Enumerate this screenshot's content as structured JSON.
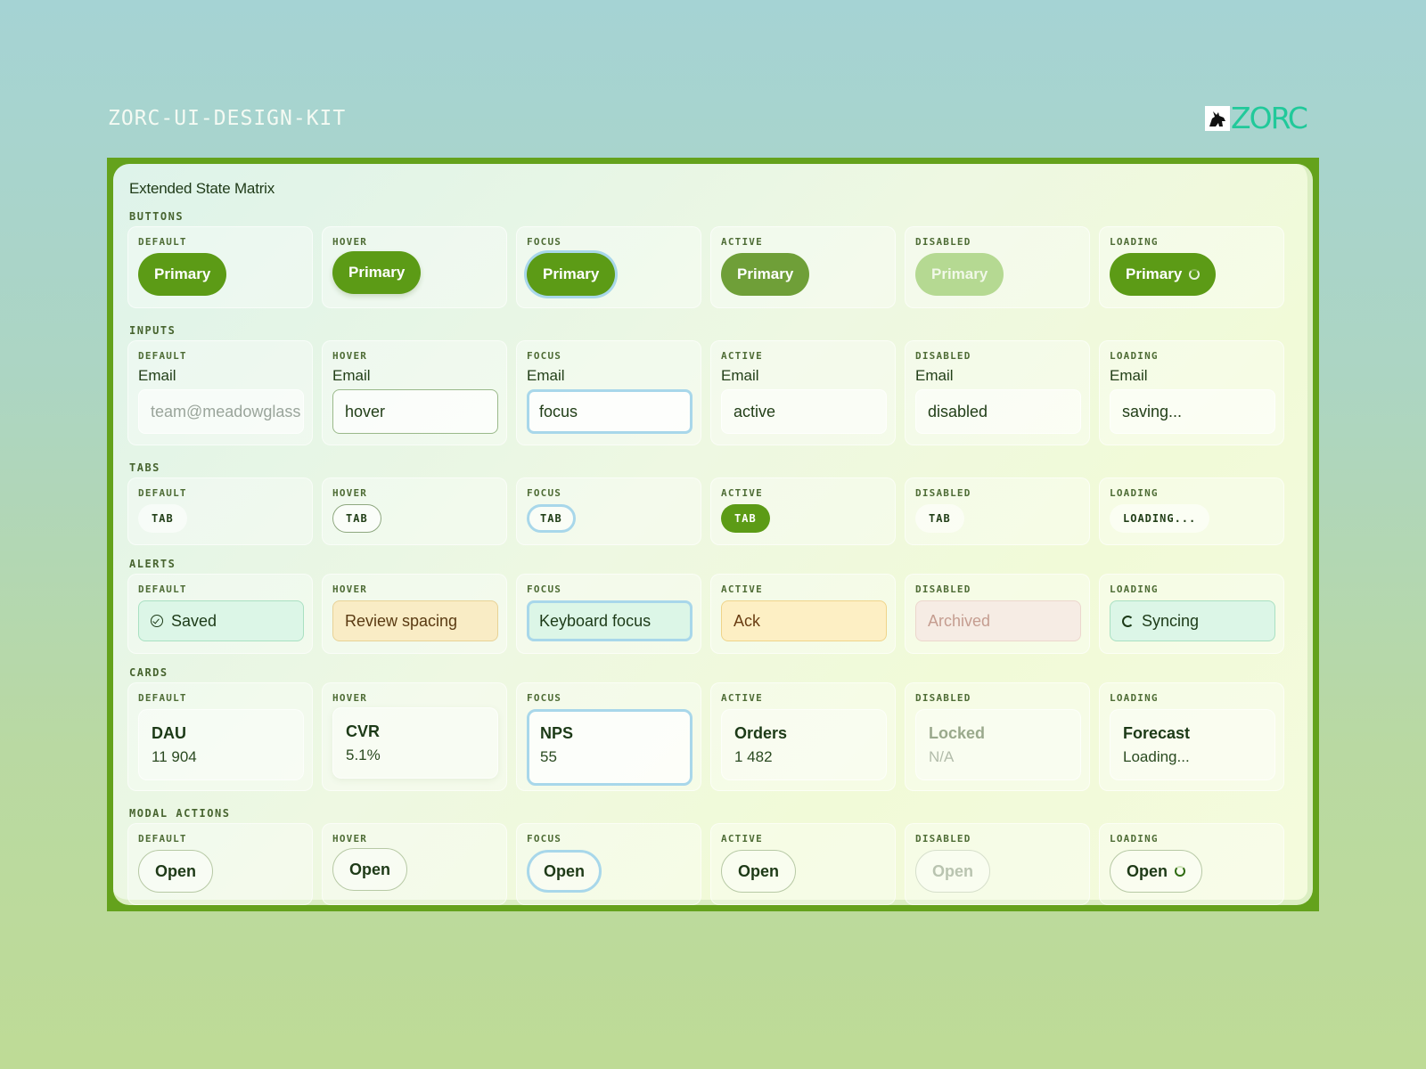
{
  "header": {
    "kit_title": "ZORC-UI-DESIGN-KIT",
    "logo_text": "ZORC"
  },
  "colors": {
    "accent": "#5c9b16",
    "frame": "#64a21c",
    "focus_ring": "#a8d7ea",
    "logo": "#21c99a"
  },
  "panel": {
    "title": "Extended State Matrix"
  },
  "states": [
    "DEFAULT",
    "HOVER",
    "FOCUS",
    "ACTIVE",
    "DISABLED",
    "LOADING"
  ],
  "sections": {
    "buttons": {
      "label": "BUTTONS",
      "items": [
        "Primary",
        "Primary",
        "Primary",
        "Primary",
        "Primary",
        "Primary"
      ]
    },
    "inputs": {
      "label": "INPUTS",
      "field_label": "Email",
      "values": [
        "team@meadowglass",
        "hover",
        "focus",
        "active",
        "disabled",
        "saving..."
      ]
    },
    "tabs": {
      "label": "TABS",
      "items": [
        "TAB",
        "TAB",
        "TAB",
        "TAB",
        "TAB",
        "LOADING..."
      ]
    },
    "alerts": {
      "label": "ALERTS",
      "items": [
        "Saved",
        "Review spacing",
        "Keyboard focus",
        "Ack",
        "Archived",
        "Syncing"
      ]
    },
    "cards": {
      "label": "CARDS",
      "items": [
        {
          "title": "DAU",
          "value": "11 904"
        },
        {
          "title": "CVR",
          "value": "5.1%"
        },
        {
          "title": "NPS",
          "value": "55"
        },
        {
          "title": "Orders",
          "value": "1 482"
        },
        {
          "title": "Locked",
          "value": "N/A"
        },
        {
          "title": "Forecast",
          "value": "Loading..."
        }
      ]
    },
    "modal_actions": {
      "label": "MODAL ACTIONS",
      "items": [
        "Open",
        "Open",
        "Open",
        "Open",
        "Open",
        "Open"
      ]
    }
  }
}
